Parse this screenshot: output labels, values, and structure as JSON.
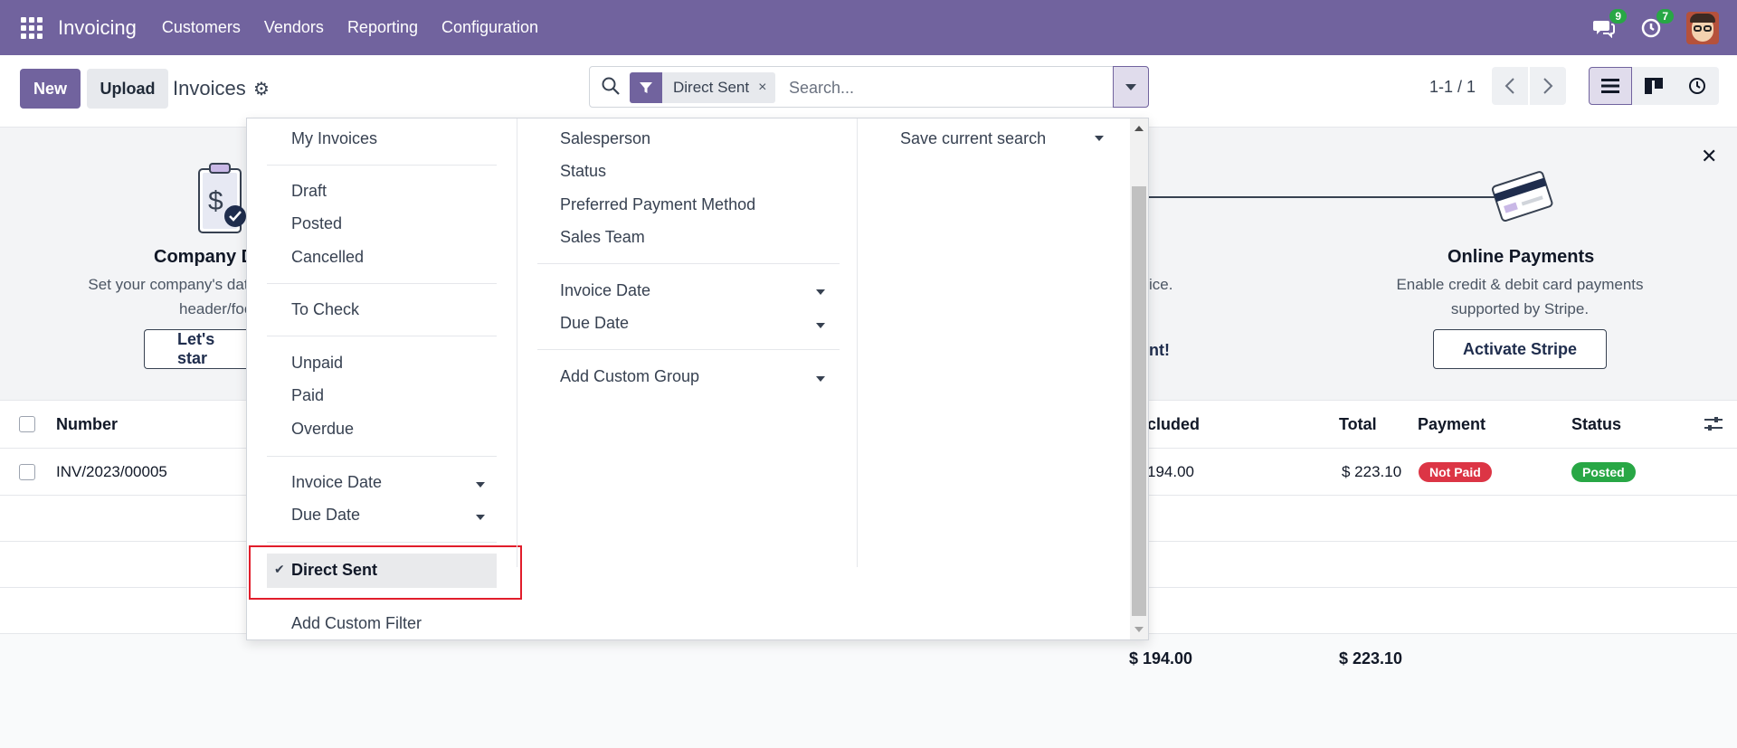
{
  "navbar": {
    "app_name": "Invoicing",
    "menu": [
      "Customers",
      "Vendors",
      "Reporting",
      "Configuration"
    ],
    "messages_count": "9",
    "activities_count": "7"
  },
  "control": {
    "new_label": "New",
    "upload_label": "Upload",
    "title": "Invoices",
    "search": {
      "facet_label": "Direct Sent",
      "facet_remove": "×",
      "placeholder": "Search..."
    },
    "pager": "1-1 / 1"
  },
  "banner": {
    "step1": {
      "title": "Company D",
      "desc_line1": "Set your company's data",
      "desc_line2": "header/foot",
      "button": "Let's star"
    },
    "step2": {
      "desc_line1": "ice.",
      "button": "nt!"
    },
    "step3": {
      "title": "Online Payments",
      "desc_line1": "Enable credit & debit card payments",
      "desc_line2": "supported by Stripe.",
      "button": "Activate Stripe"
    }
  },
  "list": {
    "columns": {
      "number": "Number",
      "tax_included": "cluded",
      "total": "Total",
      "payment": "Payment",
      "status": "Status"
    },
    "rows": [
      {
        "number": "INV/2023/00005",
        "tax_included": "194.00",
        "total": "$ 223.10",
        "payment": "Not Paid",
        "status": "Posted"
      }
    ],
    "totals": {
      "tax_included": "$ 194.00",
      "total": "$ 223.10"
    }
  },
  "dropdown": {
    "filters": {
      "my_invoices": "My Invoices",
      "draft": "Draft",
      "posted": "Posted",
      "cancelled": "Cancelled",
      "to_check": "To Check",
      "unpaid": "Unpaid",
      "paid": "Paid",
      "overdue": "Overdue",
      "invoice_date": "Invoice Date",
      "due_date": "Due Date",
      "direct_sent": "Direct Sent",
      "add_custom_filter": "Add Custom Filter"
    },
    "group_by": {
      "salesperson": "Salesperson",
      "status": "Status",
      "preferred_payment_method": "Preferred Payment Method",
      "sales_team": "Sales Team",
      "invoice_date": "Invoice Date",
      "due_date": "Due Date",
      "add_custom_group": "Add Custom Group"
    },
    "favorites": {
      "save_current_search": "Save current search"
    }
  },
  "colors": {
    "brand": "#71639e",
    "danger": "#dc3545",
    "success": "#28a745",
    "highlight": "#e11d2b"
  }
}
